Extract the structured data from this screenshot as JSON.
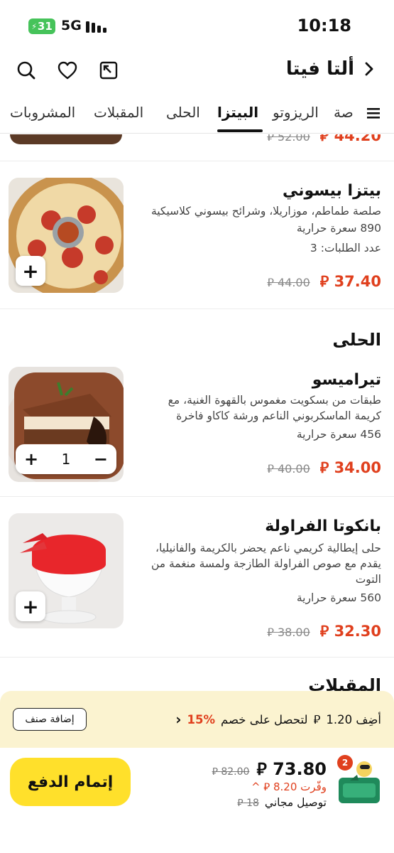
{
  "status_bar": {
    "time": "10:18",
    "battery": "31",
    "network": "5G"
  },
  "header": {
    "title": "ألتا فيتا"
  },
  "tabs": [
    {
      "label": "المشروبات"
    },
    {
      "label": "المقبلات"
    },
    {
      "label": "الحلى"
    },
    {
      "label": "البيتزا",
      "active": true
    },
    {
      "label": "الريزوتو"
    },
    {
      "label": "صة"
    }
  ],
  "partial_item": {
    "price": "44.20",
    "old_price": "52.00"
  },
  "items": [
    {
      "name": "بيتزا بيسوني",
      "description": "صلصة طماطم، موزاريلا، وشرائح بيسوني كلاسيكية",
      "calories": "890 سعرة حرارية",
      "orders": "عدد الطلبات: 3",
      "price": "37.40",
      "old_price": "44.00"
    },
    {
      "name": "تيراميسو",
      "description": "طبقات من بسكويت مغموس بالقهوة الغنية، مع كريمة الماسكربوني الناعم ورشة كاكاو فاخرة",
      "calories": "456 سعرة حرارية",
      "price": "34.00",
      "old_price": "40.00",
      "quantity": "1"
    },
    {
      "name": "بانكوتا الفراولة",
      "description": "حلى إيطالية كريمي ناعم يحضر بالكريمة والفانيليا، يقدم مع صوص الفراولة الطازجة ولمسة منغمة من التوت",
      "calories": "560 سعرة حرارية",
      "price": "32.30",
      "old_price": "38.00"
    }
  ],
  "sections": {
    "desserts": "الحلى",
    "appetizers": "المقبلات"
  },
  "currency_symbol": "⃁",
  "promo": {
    "text_prefix": "أضِف 1.20",
    "text_suffix": "لتحصل على خصم",
    "percent": "15%",
    "add_item_label": "إضافة صنف"
  },
  "checkout": {
    "button_label": "إتمام الدفع",
    "total": "73.80",
    "old_total": "82.00",
    "saved": "وفّرت 8.20",
    "delivery": "توصيل مجاني",
    "delivery_old": "18",
    "basket_count": "2"
  },
  "colors": {
    "accent": "#e0401e",
    "checkout_button": "#ffe02b",
    "promo_bg": "#fbf3d0"
  }
}
